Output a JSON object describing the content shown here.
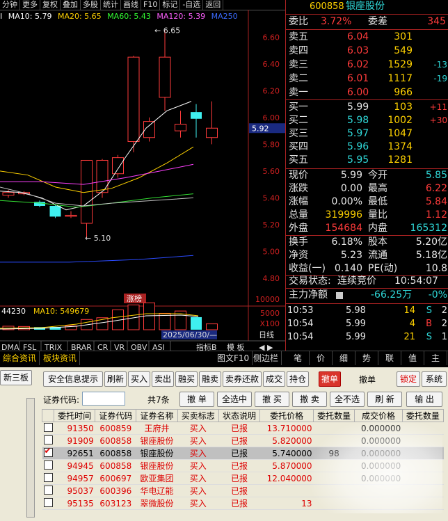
{
  "toolbar": {
    "items": [
      "分钟",
      "更多",
      "复权",
      "叠加",
      "多股",
      "统计",
      "画线",
      "F10",
      "标记",
      "-自选",
      "返回"
    ]
  },
  "ma_line": {
    "ma10": "MA10: 5.79",
    "ma20": "MA20: 5.65",
    "ma60": "MA60: 5.43",
    "ma120": "MA120: 5.39",
    "ma250": "MA250",
    "prefix": "I"
  },
  "price_axis": [
    "6.60",
    "6.40",
    "6.20",
    "6.00",
    "5.80",
    "5.60",
    "5.40",
    "5.20",
    "5.00",
    "4.80"
  ],
  "price_marker": "5.92",
  "annotations": {
    "high": "6.65",
    "low": "5.10",
    "tag": "涨榜"
  },
  "volume": {
    "label_a": "44230",
    "label_ma10": "MA10: 549679",
    "axis": [
      "10000",
      "5000",
      "X100"
    ],
    "date": "2025/06/30/—",
    "xlabel": "日线"
  },
  "indicator_tabs": [
    "DMA",
    "FSL",
    "TRIX",
    "BRAR",
    "CR",
    "VR",
    "OBV",
    "ASI"
  ],
  "indicator_right": [
    "指标B",
    "模",
    "板"
  ],
  "chart_data": {
    "type": "candlestick",
    "candles": [
      {
        "o": 5.42,
        "c": 5.44,
        "h": 5.46,
        "l": 5.4
      },
      {
        "o": 5.43,
        "c": 5.44,
        "h": 5.45,
        "l": 5.42
      },
      {
        "o": 5.37,
        "c": 5.34,
        "h": 5.38,
        "l": 5.33
      },
      {
        "o": 5.34,
        "c": 5.26,
        "h": 5.35,
        "l": 5.25
      },
      {
        "o": 5.27,
        "c": 5.27,
        "h": 5.3,
        "l": 5.25
      },
      {
        "o": 5.21,
        "c": 5.68,
        "h": 5.68,
        "l": 5.1
      },
      {
        "o": 5.44,
        "c": 5.68,
        "h": 5.69,
        "l": 5.4
      },
      {
        "o": 5.58,
        "c": 5.7,
        "h": 5.72,
        "l": 5.55
      },
      {
        "o": 5.82,
        "c": 6.45,
        "h": 6.46,
        "l": 5.74
      },
      {
        "o": 5.85,
        "c": 5.97,
        "h": 6.0,
        "l": 5.82
      },
      {
        "o": 6.15,
        "c": 6.45,
        "h": 6.65,
        "l": 6.05
      },
      {
        "o": 5.9,
        "c": 5.95,
        "h": 6.05,
        "l": 5.85
      },
      {
        "o": 6.04,
        "c": 5.99,
        "h": 6.1,
        "l": 5.85
      },
      {
        "o": 5.85,
        "c": 5.92,
        "h": 6.12,
        "l": 5.8
      }
    ],
    "volumes": [
      1200,
      1100,
      900,
      950,
      1300,
      3500,
      4100,
      6800,
      8500,
      9200,
      5600,
      6400,
      4300,
      2000
    ],
    "ylim": [
      4.8,
      6.7
    ]
  },
  "quote": {
    "code": "600858",
    "name": "银座股份",
    "weibi_label": "委比",
    "weibi": "3.72%",
    "weicha_label": "委差",
    "weicha": "345",
    "asks": [
      {
        "l": "卖五",
        "p": "6.04",
        "v": "301",
        "d": ""
      },
      {
        "l": "卖四",
        "p": "6.03",
        "v": "549",
        "d": ""
      },
      {
        "l": "卖三",
        "p": "6.02",
        "v": "1529",
        "d": "-13"
      },
      {
        "l": "卖二",
        "p": "6.01",
        "v": "1117",
        "d": "-19"
      },
      {
        "l": "卖一",
        "p": "6.00",
        "v": "966",
        "d": ""
      }
    ],
    "bids": [
      {
        "l": "买一",
        "p": "5.99",
        "v": "103",
        "d": "+11"
      },
      {
        "l": "买二",
        "p": "5.98",
        "v": "1002",
        "d": "+30"
      },
      {
        "l": "买三",
        "p": "5.97",
        "v": "1047",
        "d": ""
      },
      {
        "l": "买四",
        "p": "5.96",
        "v": "1374",
        "d": ""
      },
      {
        "l": "买五",
        "p": "5.95",
        "v": "1281",
        "d": ""
      }
    ],
    "stats": [
      {
        "l1": "现价",
        "v1": "5.99",
        "l2": "今开",
        "v2": "5.85"
      },
      {
        "l1": "涨跌",
        "v1": "0.00",
        "l2": "最高",
        "v2": "6.22"
      },
      {
        "l1": "涨幅",
        "v1": "0.00%",
        "l2": "最低",
        "v2": "5.84"
      },
      {
        "l1": "总量",
        "v1": "319996",
        "l2": "量比",
        "v2": "1.12"
      },
      {
        "l1": "外盘",
        "v1": "154684",
        "l2": "内盘",
        "v2": "165312"
      }
    ],
    "stats2": [
      {
        "l1": "换手",
        "v1": "6.18%",
        "l2": "股本",
        "v2": "5.20亿"
      },
      {
        "l1": "净资",
        "v1": "5.23",
        "l2": "流通",
        "v2": "5.18亿"
      },
      {
        "l1": "收益(一)",
        "v1": "0.140",
        "l2": "PE(动)",
        "v2": "10.8"
      }
    ],
    "status_label": "交易状态:",
    "status": "连续竞价",
    "status_time": "10:54:07",
    "main_label": "主力净额",
    "main_val": "-66.25万",
    "main_pct": "-0%",
    "ticks": [
      {
        "t": "10:53",
        "p": "5.98",
        "v": "14",
        "s": "S",
        "n": "2"
      },
      {
        "t": "10:54",
        "p": "5.99",
        "v": "4",
        "s": "B",
        "n": "2"
      },
      {
        "t": "10:54",
        "p": "5.99",
        "v": "21",
        "s": "S",
        "n": "1"
      }
    ]
  },
  "tabs_left": [
    "综合资讯",
    "板块资讯"
  ],
  "tabs_mid": [
    "图文F10",
    "侧边栏"
  ],
  "tabs_right": [
    "笔",
    "价",
    "细",
    "势",
    "联",
    "值",
    "主"
  ],
  "trade": {
    "side_tab": "新三板",
    "buttons": [
      "安全信息提示",
      "刷新",
      "买入",
      "卖出",
      "融买",
      "融卖",
      "卖券还款",
      "成交",
      "持仓"
    ],
    "red_btn": "撤单",
    "label_cd": "撤单",
    "lock": "锁定",
    "sys": "系统",
    "code_label": "证券代码:",
    "count": "共7条",
    "btns2": [
      "撤 单",
      "全选中",
      "撤 买",
      "撤 卖",
      "全不选",
      "刷 新",
      "输 出"
    ],
    "headers": [
      "委托时间",
      "证券代码",
      "证券名称",
      "买卖标志",
      "状态说明",
      "委托价格",
      "委托数量",
      "成交价格",
      "委托数量"
    ],
    "rows": [
      {
        "time": "91350",
        "code": "600859",
        "name": "王府井",
        "side": "买入",
        "status": "已报",
        "price": "13.710000",
        "qty": "",
        "deal": "0.000000",
        "q2": ""
      },
      {
        "time": "91909",
        "code": "600858",
        "name": "银座股份",
        "side": "买入",
        "status": "已报",
        "price": "5.820000",
        "qty": "",
        "deal": "0.000000",
        "q2": ""
      },
      {
        "time": "92651",
        "code": "600858",
        "name": "银座股份",
        "side": "买入",
        "status": "已报",
        "price": "5.740000",
        "qty": "98",
        "deal": "0.000000",
        "q2": ""
      },
      {
        "time": "94945",
        "code": "600858",
        "name": "银座股份",
        "side": "买入",
        "status": "已报",
        "price": "5.870000",
        "qty": "",
        "deal": "0.000000",
        "q2": ""
      },
      {
        "time": "94957",
        "code": "600697",
        "name": "欧亚集团",
        "side": "买入",
        "status": "已报",
        "price": "12.040000",
        "qty": "",
        "deal": "0.000000",
        "q2": ""
      },
      {
        "time": "95037",
        "code": "600396",
        "name": "华电辽能",
        "side": "买入",
        "status": "已报",
        "price": "",
        "qty": "",
        "deal": "",
        "q2": ""
      },
      {
        "time": "95135",
        "code": "603123",
        "name": "翠微股份",
        "side": "买入",
        "status": "已报",
        "price": "13",
        "qty": "",
        "deal": "",
        "q2": ""
      }
    ]
  }
}
